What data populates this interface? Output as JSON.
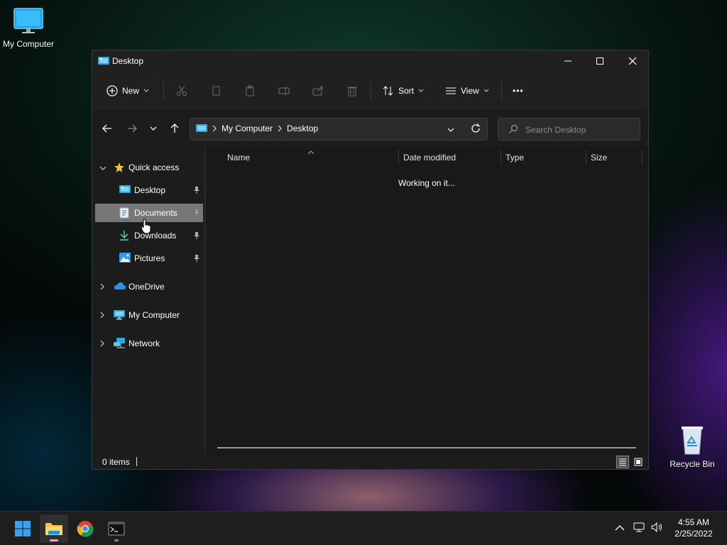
{
  "desktop": {
    "icons": [
      {
        "label": "My Computer"
      },
      {
        "label": "Recycle Bin"
      }
    ]
  },
  "window": {
    "title": "Desktop",
    "commands": {
      "new_label": "New",
      "sort_label": "Sort",
      "view_label": "View",
      "more_label": "•••"
    },
    "address": {
      "crumbs": [
        "My Computer",
        "Desktop"
      ]
    },
    "search": {
      "placeholder": "Search Desktop"
    },
    "nav": {
      "quick_access": "Quick access",
      "items": [
        {
          "label": "Desktop",
          "pinned": true
        },
        {
          "label": "Documents",
          "pinned": true,
          "selected": true
        },
        {
          "label": "Downloads",
          "pinned": true
        },
        {
          "label": "Pictures",
          "pinned": true
        }
      ],
      "onedrive": "OneDrive",
      "my_computer": "My Computer",
      "network": "Network"
    },
    "columns": [
      "Name",
      "Date modified",
      "Type",
      "Size"
    ],
    "status_message": "Working on it...",
    "statusbar": {
      "item_count": "0 items"
    }
  },
  "taskbar": {
    "clock": {
      "time": "4:55 AM",
      "date": "2/25/2022"
    }
  },
  "colors": {
    "accent": "#0078d4",
    "selected_bg": "#777777",
    "window_bg": "#1c1c1c"
  }
}
